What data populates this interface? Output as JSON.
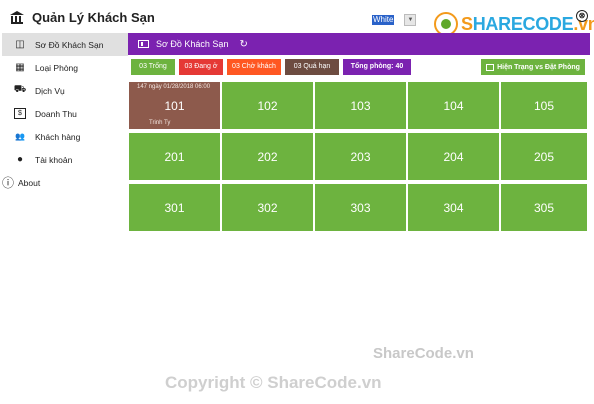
{
  "app": {
    "title": "Quản Lý Khách Sạn",
    "theme": "White",
    "close_glyph": "⊗"
  },
  "logo": {
    "prefix": "S",
    "brand": "HARECODE",
    "suffix": ".vn"
  },
  "sidebar": {
    "items": [
      {
        "label": "Sơ Đồ Khách Sạn",
        "icon": "map-icon",
        "glyph": "◫",
        "active": true
      },
      {
        "label": "Loại Phòng",
        "icon": "building-icon",
        "glyph": "▦",
        "active": false
      },
      {
        "label": "Dịch Vụ",
        "icon": "delivery-truck-icon",
        "glyph": "⛟",
        "active": false
      },
      {
        "label": "Doanh Thu",
        "icon": "money-icon",
        "glyph": "$",
        "active": false
      },
      {
        "label": "Khách hàng",
        "icon": "users-icon",
        "glyph": "👥",
        "active": false
      },
      {
        "label": "Tài khoản",
        "icon": "user-icon",
        "glyph": "●",
        "active": false
      },
      {
        "label": "About",
        "icon": "info-icon",
        "glyph": "ⓘ",
        "active": false
      }
    ]
  },
  "header": {
    "title": "Sơ Đồ Khách Sạn",
    "refresh_glyph": "↻"
  },
  "legend": {
    "empty": "03 Trống",
    "occupied": "03 Đang ở",
    "waiting": "03 Chờ khách",
    "overdue": "03 Quá hạn",
    "total": "Tổng phòng: 40"
  },
  "status_button": "Hiện Trạng vs Đặt Phòng",
  "rooms": [
    {
      "number": "101",
      "status": "busy",
      "sub": "147 ngày 01/28/2018 06:00",
      "guest": "Trinh Ty"
    },
    {
      "number": "102",
      "status": "empty"
    },
    {
      "number": "103",
      "status": "empty"
    },
    {
      "number": "104",
      "status": "empty"
    },
    {
      "number": "105",
      "status": "empty"
    },
    {
      "number": "201",
      "status": "empty"
    },
    {
      "number": "202",
      "status": "empty"
    },
    {
      "number": "203",
      "status": "empty"
    },
    {
      "number": "204",
      "status": "empty"
    },
    {
      "number": "205",
      "status": "empty"
    },
    {
      "number": "301",
      "status": "empty"
    },
    {
      "number": "302",
      "status": "empty"
    },
    {
      "number": "303",
      "status": "empty"
    },
    {
      "number": "304",
      "status": "empty"
    },
    {
      "number": "305",
      "status": "empty"
    }
  ],
  "watermarks": {
    "top": "ShareCode.vn",
    "bottom": "Copyright © ShareCode.vn"
  },
  "colors": {
    "green": "#6db33f",
    "purple": "#7b22b0",
    "red": "#e53935",
    "orange": "#ff5722",
    "brown": "#6d4c41"
  }
}
